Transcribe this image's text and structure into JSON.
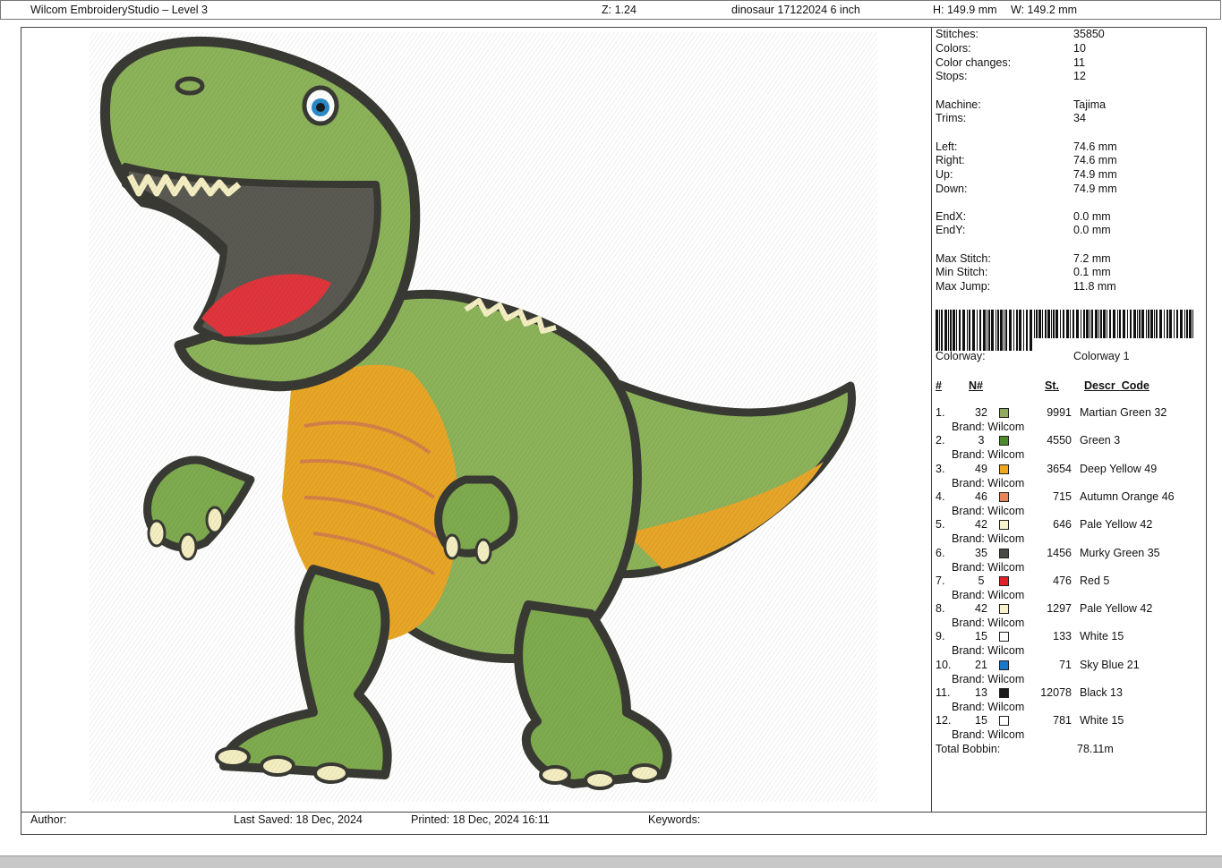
{
  "header": {
    "app_title": "Wilcom EmbroideryStudio – Level 3",
    "zoom": "Z: 1.24",
    "design_name": "dinosaur 17122024 6 inch",
    "height": "H: 149.9 mm",
    "width": "W: 149.2 mm"
  },
  "stats": [
    {
      "label": "Stitches:",
      "value": "35850"
    },
    {
      "label": "Colors:",
      "value": "10"
    },
    {
      "label": "Color changes:",
      "value": "11"
    },
    {
      "label": "Stops:",
      "value": "12"
    },
    {
      "label": "Machine:",
      "value": "Tajima"
    },
    {
      "label": "Trims:",
      "value": "34"
    },
    {
      "label": "Left:",
      "value": "74.6 mm"
    },
    {
      "label": "Right:",
      "value": "74.6 mm"
    },
    {
      "label": "Up:",
      "value": "74.9 mm"
    },
    {
      "label": "Down:",
      "value": "74.9 mm"
    },
    {
      "label": "EndX:",
      "value": "0.0 mm"
    },
    {
      "label": "EndY:",
      "value": "0.0 mm"
    },
    {
      "label": "Max Stitch:",
      "value": "7.2 mm"
    },
    {
      "label": "Min Stitch:",
      "value": "0.1 mm"
    },
    {
      "label": "Max Jump:",
      "value": "11.8 mm"
    }
  ],
  "colorway": {
    "label": "Colorway:",
    "value": "Colorway 1"
  },
  "thread_table": {
    "headers": {
      "index": "#",
      "number": "N#",
      "stitches": "St.",
      "description": "Descr_Code"
    },
    "rows": [
      {
        "index": "1.",
        "number": "32",
        "color": "#8faa5e",
        "stitches": "9991",
        "description": "Martian Green 32",
        "brand": "Brand: Wilcom"
      },
      {
        "index": "2.",
        "number": "3",
        "color": "#4e8a2e",
        "stitches": "4550",
        "description": "Green 3",
        "brand": "Brand: Wilcom"
      },
      {
        "index": "3.",
        "number": "49",
        "color": "#f0a820",
        "stitches": "3654",
        "description": "Deep Yellow 49",
        "brand": "Brand: Wilcom"
      },
      {
        "index": "4.",
        "number": "46",
        "color": "#e8845a",
        "stitches": "715",
        "description": "Autumn Orange 46",
        "brand": "Brand: Wilcom"
      },
      {
        "index": "5.",
        "number": "42",
        "color": "#f6f2cc",
        "stitches": "646",
        "description": "Pale Yellow 42",
        "brand": "Brand: Wilcom"
      },
      {
        "index": "6.",
        "number": "35",
        "color": "#4a4a44",
        "stitches": "1456",
        "description": "Murky Green 35",
        "brand": "Brand: Wilcom"
      },
      {
        "index": "7.",
        "number": "5",
        "color": "#e0202a",
        "stitches": "476",
        "description": "Red 5",
        "brand": "Brand: Wilcom"
      },
      {
        "index": "8.",
        "number": "42",
        "color": "#f6f2cc",
        "stitches": "1297",
        "description": "Pale Yellow 42",
        "brand": "Brand: Wilcom"
      },
      {
        "index": "9.",
        "number": "15",
        "color": "#ffffff",
        "stitches": "133",
        "description": "White 15",
        "brand": "Brand: Wilcom"
      },
      {
        "index": "10.",
        "number": "21",
        "color": "#1a78c8",
        "stitches": "71",
        "description": "Sky Blue 21",
        "brand": "Brand: Wilcom"
      },
      {
        "index": "11.",
        "number": "13",
        "color": "#1a1a1a",
        "stitches": "12078",
        "description": "Black 13",
        "brand": "Brand: Wilcom"
      },
      {
        "index": "12.",
        "number": "15",
        "color": "#ffffff",
        "stitches": "781",
        "description": "White 15",
        "brand": "Brand: Wilcom"
      }
    ]
  },
  "total_bobbin": {
    "label": "Total Bobbin:",
    "value": "78.11m"
  },
  "footer": {
    "author": "Author:",
    "last_saved": "Last Saved: 18 Dec, 2024",
    "printed": "Printed: 18 Dec, 2024 16:11",
    "keywords": "Keywords:"
  }
}
